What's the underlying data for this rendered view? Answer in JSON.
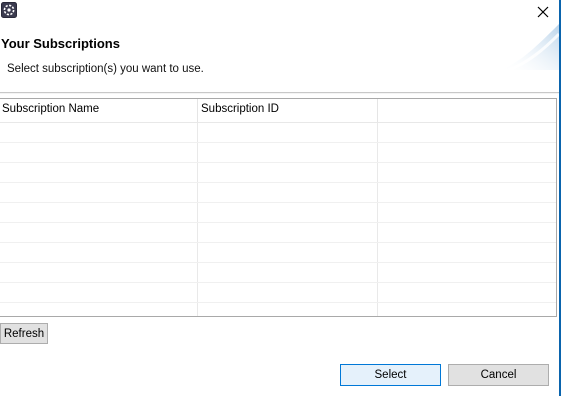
{
  "window": {
    "icons": {
      "app": "app-logo-icon",
      "close": "close-icon"
    },
    "close_glyph": "✕"
  },
  "header": {
    "title": "Your Subscriptions",
    "description": "Select subscription(s) you want to use."
  },
  "table": {
    "columns": [
      "Subscription Name",
      "Subscription ID",
      ""
    ],
    "rows": []
  },
  "buttons": {
    "refresh": "Refresh",
    "select": "Select",
    "cancel": "Cancel"
  },
  "colors": {
    "accent_border": "#0a64ad",
    "default_button_border": "#0078d7"
  }
}
